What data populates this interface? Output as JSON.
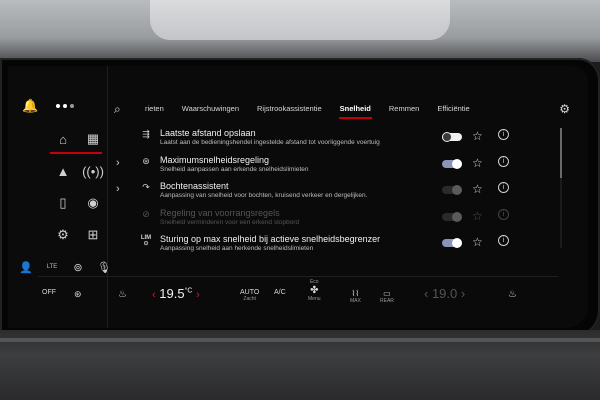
{
  "tabs": [
    {
      "label": "rieten",
      "active": false
    },
    {
      "label": "Waarschuwingen",
      "active": false
    },
    {
      "label": "Rijstrookassistentie",
      "active": false
    },
    {
      "label": "Snelheid",
      "active": true
    },
    {
      "label": "Remmen",
      "active": false
    },
    {
      "label": "Efficiëntie",
      "active": false
    }
  ],
  "rows": [
    {
      "title": "Laatste afstand opslaan",
      "subtitle": "Laatst aan de bedieningshendel ingestelde afstand tot voorliggende voertuig",
      "toggle": "off",
      "expandable": false,
      "disabled": false
    },
    {
      "title": "Maximumsnelheidsregeling",
      "subtitle": "Snelheid aanpassen aan erkende snelheidslimieten",
      "toggle": "on",
      "expandable": true,
      "disabled": false
    },
    {
      "title": "Bochtenassistent",
      "subtitle": "Aanpassing van snelheid voor bochten, kruisend verkeer en dergelijken.",
      "toggle": "dim",
      "expandable": true,
      "disabled": false
    },
    {
      "title": "Regeling van voorrangsregels",
      "subtitle": "Snelheid verminderen voor een erkend stopbord",
      "toggle": "dim",
      "expandable": false,
      "disabled": true
    },
    {
      "title": "Sturing op max snelheid bij actieve snelheidsbegrenzer",
      "subtitle": "Aanpassing snelheid aan herkende snelheidslimieten",
      "toggle": "on",
      "expandable": false,
      "disabled": false
    }
  ],
  "climate": {
    "off_label": "OFF",
    "temp_left": "19.5",
    "temp_unit": "°C",
    "auto_label": "AUTO",
    "auto_sub": "Zacht",
    "ac_label": "A/C",
    "eco_label": "Eco",
    "menu_label": "Menu",
    "max_label": "MAX",
    "rear_label": "REAR",
    "temp_right": "19.0"
  },
  "rail": {
    "lte_label": "LTE",
    "lim_label": "LIM"
  },
  "colors": {
    "accent": "#c4000f",
    "toggle_on": "#8a93b8"
  }
}
